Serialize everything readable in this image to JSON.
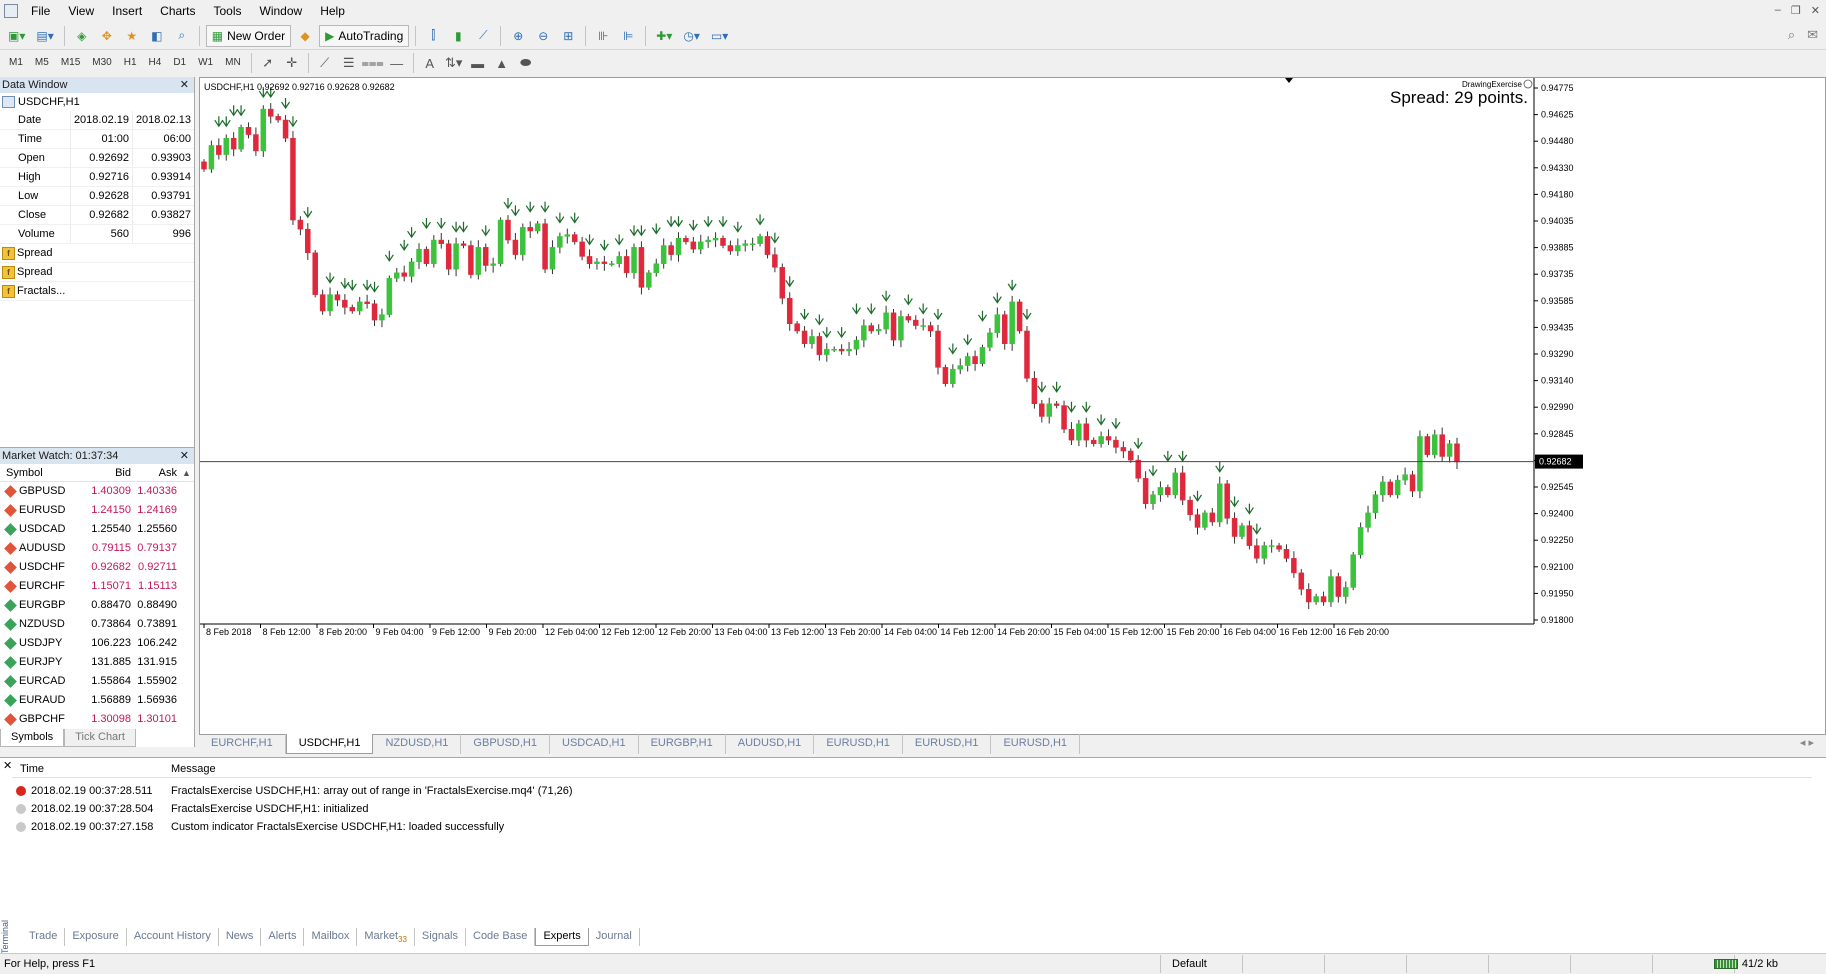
{
  "menubar": {
    "items": [
      "File",
      "View",
      "Insert",
      "Charts",
      "Tools",
      "Window",
      "Help"
    ]
  },
  "toolbar": {
    "new_order": "New Order",
    "autotrading": "AutoTrading"
  },
  "timeframes": [
    "M1",
    "M5",
    "M15",
    "M30",
    "H1",
    "H4",
    "D1",
    "W1",
    "MN"
  ],
  "data_window": {
    "title": "Data Window",
    "symbol": "USDCHF,H1",
    "rows": [
      {
        "label": "Date",
        "v1": "2018.02.19",
        "v2": "2018.02.13"
      },
      {
        "label": "Time",
        "v1": "01:00",
        "v2": "06:00"
      },
      {
        "label": "Open",
        "v1": "0.92692",
        "v2": "0.93903"
      },
      {
        "label": "High",
        "v1": "0.92716",
        "v2": "0.93914"
      },
      {
        "label": "Low",
        "v1": "0.92628",
        "v2": "0.93791"
      },
      {
        "label": "Close",
        "v1": "0.92682",
        "v2": "0.93827"
      },
      {
        "label": "Volume",
        "v1": "560",
        "v2": "996"
      }
    ],
    "indicators": [
      "Spread",
      "Spread",
      "Fractals..."
    ]
  },
  "market_watch": {
    "title": "Market Watch: 01:37:34",
    "col_symbol": "Symbol",
    "col_bid": "Bid",
    "col_ask": "Ask",
    "rows": [
      {
        "symbol": "GBPUSD",
        "bid": "1.40309",
        "ask": "1.40336",
        "dir": "down"
      },
      {
        "symbol": "EURUSD",
        "bid": "1.24150",
        "ask": "1.24169",
        "dir": "down"
      },
      {
        "symbol": "USDCAD",
        "bid": "1.25540",
        "ask": "1.25560",
        "dir": "up"
      },
      {
        "symbol": "AUDUSD",
        "bid": "0.79115",
        "ask": "0.79137",
        "dir": "down"
      },
      {
        "symbol": "USDCHF",
        "bid": "0.92682",
        "ask": "0.92711",
        "dir": "down"
      },
      {
        "symbol": "EURCHF",
        "bid": "1.15071",
        "ask": "1.15113",
        "dir": "down"
      },
      {
        "symbol": "EURGBP",
        "bid": "0.88470",
        "ask": "0.88490",
        "dir": "up"
      },
      {
        "symbol": "NZDUSD",
        "bid": "0.73864",
        "ask": "0.73891",
        "dir": "up"
      },
      {
        "symbol": "USDJPY",
        "bid": "106.223",
        "ask": "106.242",
        "dir": "up"
      },
      {
        "symbol": "EURJPY",
        "bid": "131.885",
        "ask": "131.915",
        "dir": "up"
      },
      {
        "symbol": "EURCAD",
        "bid": "1.55864",
        "ask": "1.55902",
        "dir": "up"
      },
      {
        "symbol": "EURAUD",
        "bid": "1.56889",
        "ask": "1.56936",
        "dir": "up"
      },
      {
        "symbol": "GBPCHF",
        "bid": "1.30098",
        "ask": "1.30101",
        "dir": "down"
      }
    ],
    "tabs": [
      "Symbols",
      "Tick Chart"
    ]
  },
  "chart": {
    "info_line": "USDCHF,H1  0.92692 0.92716 0.92628 0.92682",
    "spread_text": "Spread: 29 points.",
    "indicator_label": "DrawingExercise",
    "current_price": "0.92682",
    "price_labels": [
      "0.94775",
      "0.94625",
      "0.94480",
      "0.94330",
      "0.94180",
      "0.94035",
      "0.93885",
      "0.93735",
      "0.93585",
      "0.93435",
      "0.93290",
      "0.93140",
      "0.92990",
      "0.92845",
      "0.92695",
      "0.92545",
      "0.92400",
      "0.92250",
      "0.92100",
      "0.91950",
      "0.91800"
    ],
    "time_labels": [
      "8 Feb 2018",
      "8 Feb 12:00",
      "8 Feb 20:00",
      "9 Feb 04:00",
      "9 Feb 12:00",
      "9 Feb 20:00",
      "12 Feb 04:00",
      "12 Feb 12:00",
      "12 Feb 20:00",
      "13 Feb 04:00",
      "13 Feb 12:00",
      "13 Feb 20:00",
      "14 Feb 04:00",
      "14 Feb 12:00",
      "14 Feb 20:00",
      "15 Feb 04:00",
      "15 Feb 12:00",
      "15 Feb 20:00",
      "16 Feb 04:00",
      "16 Feb 12:00",
      "16 Feb 20:00"
    ],
    "tabs": [
      "EURCHF,H1",
      "USDCHF,H1",
      "NZDUSD,H1",
      "GBPUSD,H1",
      "USDCAD,H1",
      "EURGBP,H1",
      "AUDUSD,H1",
      "EURUSD,H1",
      "EURUSD,H1",
      "EURUSD,H1"
    ],
    "up_color": "#3cc23c",
    "down_color": "#e0283c",
    "fractal_color": "#1d6b2a"
  },
  "chart_data": {
    "type": "candlestick",
    "symbol": "USDCHF",
    "timeframe": "H1",
    "ylim": [
      0.918,
      0.9478
    ],
    "current_price": 0.92682,
    "closes": [
      0.9429,
      0.9442,
      0.9437,
      0.9446,
      0.944,
      0.9452,
      0.9448,
      0.9439,
      0.9462,
      0.9458,
      0.9456,
      0.9446,
      0.9401,
      0.9396,
      0.9383,
      0.936,
      0.9351,
      0.936,
      0.9357,
      0.9353,
      0.9351,
      0.9356,
      0.9355,
      0.9346,
      0.9349,
      0.9369,
      0.9372,
      0.937,
      0.9378,
      0.9385,
      0.9377,
      0.939,
      0.9388,
      0.9374,
      0.9388,
      0.9387,
      0.9371,
      0.9386,
      0.9376,
      0.9377,
      0.9401,
      0.939,
      0.9382,
      0.9397,
      0.9395,
      0.9399,
      0.9374,
      0.9386,
      0.9392,
      0.9393,
      0.9389,
      0.9381,
      0.9377,
      0.9378,
      0.9377,
      0.9377,
      0.9381,
      0.9372,
      0.9386,
      0.9364,
      0.9372,
      0.9377,
      0.9387,
      0.9382,
      0.9391,
      0.9389,
      0.9385,
      0.9389,
      0.939,
      0.9391,
      0.9387,
      0.9384,
      0.9387,
      0.9388,
      0.9388,
      0.9392,
      0.9382,
      0.9375,
      0.9358,
      0.9344,
      0.934,
      0.9333,
      0.9337,
      0.9327,
      0.933,
      0.933,
      0.9329,
      0.933,
      0.9335,
      0.9343,
      0.934,
      0.9341,
      0.935,
      0.9335,
      0.9348,
      0.9346,
      0.9343,
      0.9343,
      0.934,
      0.932,
      0.9311,
      0.9319,
      0.9321,
      0.9326,
      0.9322,
      0.9331,
      0.9339,
      0.9349,
      0.9333,
      0.9356,
      0.934,
      0.9314,
      0.93,
      0.9293,
      0.93,
      0.9299,
      0.9286,
      0.928,
      0.9289,
      0.928,
      0.9278,
      0.9282,
      0.928,
      0.9276,
      0.9274,
      0.9269,
      0.9259,
      0.9245,
      0.925,
      0.9254,
      0.925,
      0.9262,
      0.9247,
      0.9239,
      0.9232,
      0.924,
      0.9235,
      0.9256,
      0.9237,
      0.9227,
      0.9233,
      0.9222,
      0.9215,
      0.9222,
      0.9222,
      0.922,
      0.9215,
      0.9207,
      0.9198,
      0.9191,
      0.9194,
      0.9191,
      0.9205,
      0.9194,
      0.9199,
      0.9217,
      0.9232,
      0.924,
      0.925,
      0.9257,
      0.925,
      0.9258,
      0.9261,
      0.9252,
      0.9282,
      0.9272,
      0.9283,
      0.9271,
      0.9278,
      0.9268
    ],
    "fractals_up_x": [
      12,
      22,
      31,
      40,
      57,
      67,
      80,
      90,
      104,
      127,
      142,
      151,
      161,
      172,
      184,
      197,
      210,
      223,
      236,
      250,
      263,
      280,
      303,
      315,
      327,
      342,
      356,
      375,
      389,
      401,
      418,
      431,
      441,
      453,
      468,
      478,
      491,
      505,
      520,
      538,
      557,
      571,
      585,
      598,
      614,
      627,
      640,
      655,
      668,
      685,
      707,
      721,
      737,
      751,
      764,
      779,
      792,
      806,
      826,
      842,
      853,
      870,
      884,
      898,
      916,
      932,
      947,
      962,
      979,
      997,
      1015,
      1030,
      1046,
      1058
    ],
    "fractals_down_x": []
  },
  "terminal": {
    "col_time": "Time",
    "col_message": "Message",
    "logs": [
      {
        "level": "error",
        "time": "2018.02.19 00:37:28.511",
        "message": "FractalsExercise USDCHF,H1: array out of range in 'FractalsExercise.mq4' (71,26)"
      },
      {
        "level": "info",
        "time": "2018.02.19 00:37:28.504",
        "message": "FractalsExercise USDCHF,H1: initialized"
      },
      {
        "level": "info",
        "time": "2018.02.19 00:37:27.158",
        "message": "Custom indicator FractalsExercise USDCHF,H1: loaded successfully"
      }
    ],
    "side_label": "Terminal",
    "tabs": [
      "Trade",
      "Exposure",
      "Account History",
      "News",
      "Alerts",
      "Mailbox",
      "Market",
      "Signals",
      "Code Base",
      "Experts",
      "Journal"
    ],
    "market_badge": "33"
  },
  "statusbar": {
    "help": "For Help, press F1",
    "profile": "Default",
    "traffic": "41/2 kb"
  }
}
